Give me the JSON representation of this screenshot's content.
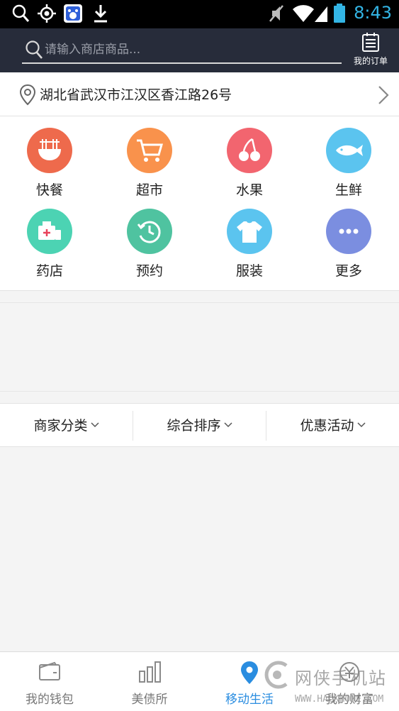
{
  "status_bar": {
    "time": "8:43"
  },
  "header": {
    "search_placeholder": "请输入商店商品...",
    "orders_label": "我的订单"
  },
  "address": {
    "text": "湖北省武汉市江汉区香江路26号"
  },
  "categories": [
    {
      "label": "快餐",
      "icon": "noodle-bowl-icon",
      "color": "#ee6a4c"
    },
    {
      "label": "超市",
      "icon": "shopping-cart-icon",
      "color": "#f9924c"
    },
    {
      "label": "水果",
      "icon": "cherry-icon",
      "color": "#f2656f"
    },
    {
      "label": "生鲜",
      "icon": "fish-icon",
      "color": "#5bc4ef"
    },
    {
      "label": "药店",
      "icon": "medicine-icon",
      "color": "#4cd3b3"
    },
    {
      "label": "预约",
      "icon": "clock-icon",
      "color": "#4fc3a0"
    },
    {
      "label": "服装",
      "icon": "tshirt-icon",
      "color": "#5bc4ef"
    },
    {
      "label": "更多",
      "icon": "more-dots-icon",
      "color": "#7b8ee0"
    }
  ],
  "filters": [
    {
      "label": "商家分类"
    },
    {
      "label": "综合排序"
    },
    {
      "label": "优惠活动"
    }
  ],
  "tabs": [
    {
      "label": "我的钱包",
      "icon": "wallet-icon"
    },
    {
      "label": "美债所",
      "icon": "bar-chart-icon"
    },
    {
      "label": "移动生活",
      "icon": "location-pin-icon",
      "active": true
    },
    {
      "label": "我的财富",
      "icon": "wealth-icon"
    }
  ],
  "watermark": {
    "text": "网侠手机站",
    "url": "WWW.HACKHOME.COM"
  },
  "colors": {
    "header_bg": "#272c3a",
    "accent": "#2a8de0",
    "time": "#33b5e5"
  }
}
